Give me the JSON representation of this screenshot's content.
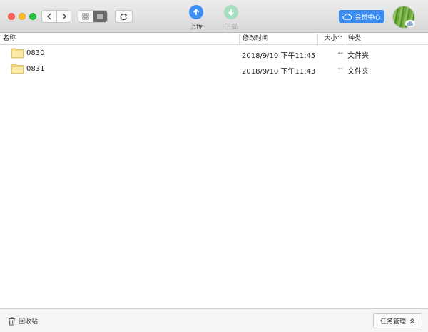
{
  "toolbar": {
    "upload_label": "上传",
    "download_label": "下载",
    "member_label": "会员中心",
    "accent_color": "#3b8cf0"
  },
  "columns": {
    "name": "名称",
    "date": "修改时间",
    "size": "大小^",
    "kind": "种类"
  },
  "files": [
    {
      "name": "0830",
      "date": "2018/9/10 下午11:45",
      "size": "--",
      "kind": "文件夹",
      "icon": "folder-icon"
    },
    {
      "name": "0831",
      "date": "2018/9/10 下午11:43",
      "size": "--",
      "kind": "文件夹",
      "icon": "folder-icon"
    }
  ],
  "bottom": {
    "trash_label": "回收站",
    "task_label": "任务管理"
  }
}
